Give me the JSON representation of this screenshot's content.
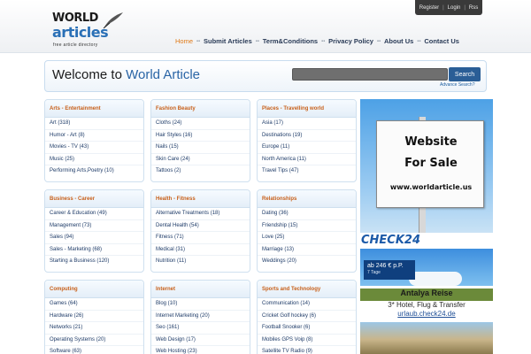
{
  "header": {
    "top_links": [
      "Register",
      "Login",
      "Rss"
    ],
    "logo": {
      "line1": "WORLD",
      "line2": "articles",
      "tagline": "free article directory"
    },
    "nav": [
      {
        "label": "Home",
        "active": true
      },
      {
        "label": "Submit Articles"
      },
      {
        "label": "Term&Conditions"
      },
      {
        "label": "Privacy Policy"
      },
      {
        "label": "About Us"
      },
      {
        "label": "Contact Us"
      }
    ]
  },
  "welcome": {
    "prefix": "Welcome to ",
    "highlight": "World Article",
    "search_value": "",
    "search_button": "Search",
    "advanced_link": "Advance Search?"
  },
  "categories": [
    {
      "title": "Arts - Entertainment",
      "items": [
        "Art (318)",
        "Humor - Art (8)",
        "Movies - TV (43)",
        "Music (25)",
        "Performing Arts,Poetry (10)"
      ]
    },
    {
      "title": "Fashion Beauty",
      "items": [
        "Cloths (24)",
        "Hair Styles (16)",
        "Nails (15)",
        "Skin Care (24)",
        "Tattoos (2)"
      ]
    },
    {
      "title": "Places - Travelling world",
      "items": [
        "Asia (17)",
        "Destinations (19)",
        "Europe (11)",
        "North America (11)",
        "Travel Tips (47)"
      ]
    },
    {
      "title": "Business - Career",
      "items": [
        "Career & Education (49)",
        "Management (73)",
        "Sales (94)",
        "Sales - Marketing (68)",
        "Starting a Business (120)"
      ]
    },
    {
      "title": "Health - Fitness",
      "items": [
        "Alternative Treatments (18)",
        "Dental Health (54)",
        "Fitness (71)",
        "Medical (31)",
        "Nutrition (11)"
      ]
    },
    {
      "title": "Relationships",
      "items": [
        "Dating (36)",
        "Friendship (15)",
        "Love (25)",
        "Marriage (13)",
        "Weddings (20)"
      ]
    },
    {
      "title": "Computing",
      "items": [
        "Games (64)",
        "Hardware (26)",
        "Networks (21)",
        "Operating Systems (20)",
        "Software (63)"
      ]
    },
    {
      "title": "Internet",
      "items": [
        "Blog (10)",
        "Internet Marketing (20)",
        "Seo (161)",
        "Web Design (17)",
        "Web Hosting (23)"
      ]
    },
    {
      "title": "Sports and Technology",
      "items": [
        "Communication (14)",
        "Cricket Golf hockey (6)",
        "Football Snooker (6)",
        "Mobiles GPS Voip (8)",
        "Satellite TV Radio (9)"
      ]
    }
  ],
  "ads": {
    "sale_sign": [
      "Website",
      "For Sale",
      "www.worldarticle.us"
    ],
    "check24": {
      "logo": "CHECK24",
      "price": "ab 246 € p.P.",
      "days": "7 Tage",
      "title": "Antalya Reise",
      "subtitle": "3* Hotel, Flug & Transfer",
      "link": "urlaub.check24.de"
    }
  },
  "colors": {
    "accent_orange": "#e07a18",
    "link_blue": "#1e3b68",
    "brand_blue": "#2a65a6",
    "search_button": "#2a5e96"
  }
}
